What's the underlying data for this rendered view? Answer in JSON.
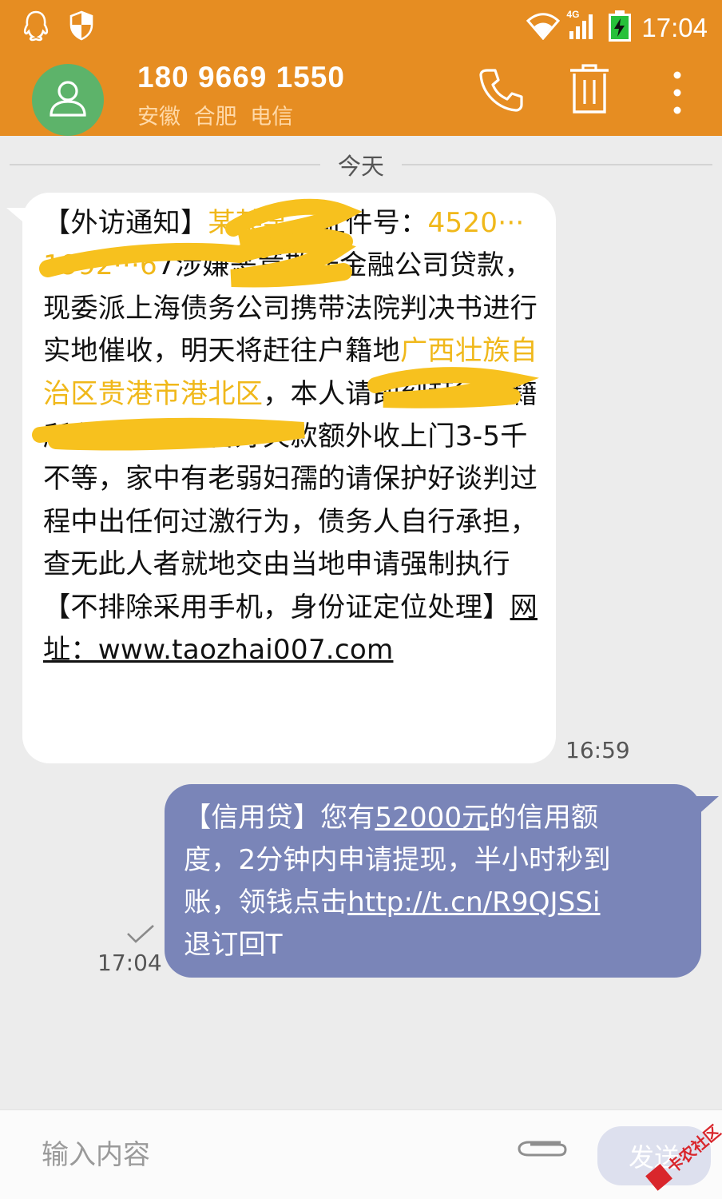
{
  "status_bar": {
    "time": "17:04",
    "network_label": "4G",
    "icons": [
      "qq-icon",
      "shield-icon",
      "wifi-icon",
      "signal-icon",
      "battery-charging-icon"
    ]
  },
  "header": {
    "contact_number": "180 9669 1550",
    "contact_location": "安徽 合肥 电信",
    "avatar_icon": "person-icon",
    "actions": [
      "phone-icon",
      "trash-icon",
      "more-vert-icon"
    ]
  },
  "conversation": {
    "date_separator": "今天",
    "incoming": {
      "text_part1": "【外访通知】",
      "text_redacted1": "某某某",
      "text_part2": "，证件号：",
      "text_redacted2": "4520···1992···6",
      "text_part3": "7涉嫌恶意欺诈金融公司贷款，现委派上海债务公司携带法院判决书进行实地催收，明天将赶往户籍地",
      "text_redacted3": "广西壮族自治区贵港市港北区",
      "text_part4": "，本人请即刻赶往户籍所在地，请准备好欠款额外收上门3-5千不等，家中有老弱妇孺的请保护好谈判过程中出任何过激行为，债务人自行承担，查无此人者就地交由当地申请强制执行【不排除采用手机，身份证定位处理】",
      "link_label": "网址：www.taozhai007.com",
      "time": "16:59"
    },
    "outgoing": {
      "text_part1": "【信用贷】您有",
      "amount": "52000元",
      "text_part2": "的信用额度，2分钟内申请提现，半小时秒到账，领钱点击",
      "link": "http://t.cn/R9QJSSi",
      "text_part3": " 退订回T",
      "time": "17:04"
    }
  },
  "composer": {
    "placeholder": "输入内容",
    "send_label": "发送",
    "watermark": "卡农社区"
  },
  "colors": {
    "header": "#e68d22",
    "avatar": "#5db36a",
    "outgoing_bubble": "#7a85b8",
    "background": "#ececec",
    "redaction": "#f7c11e"
  }
}
